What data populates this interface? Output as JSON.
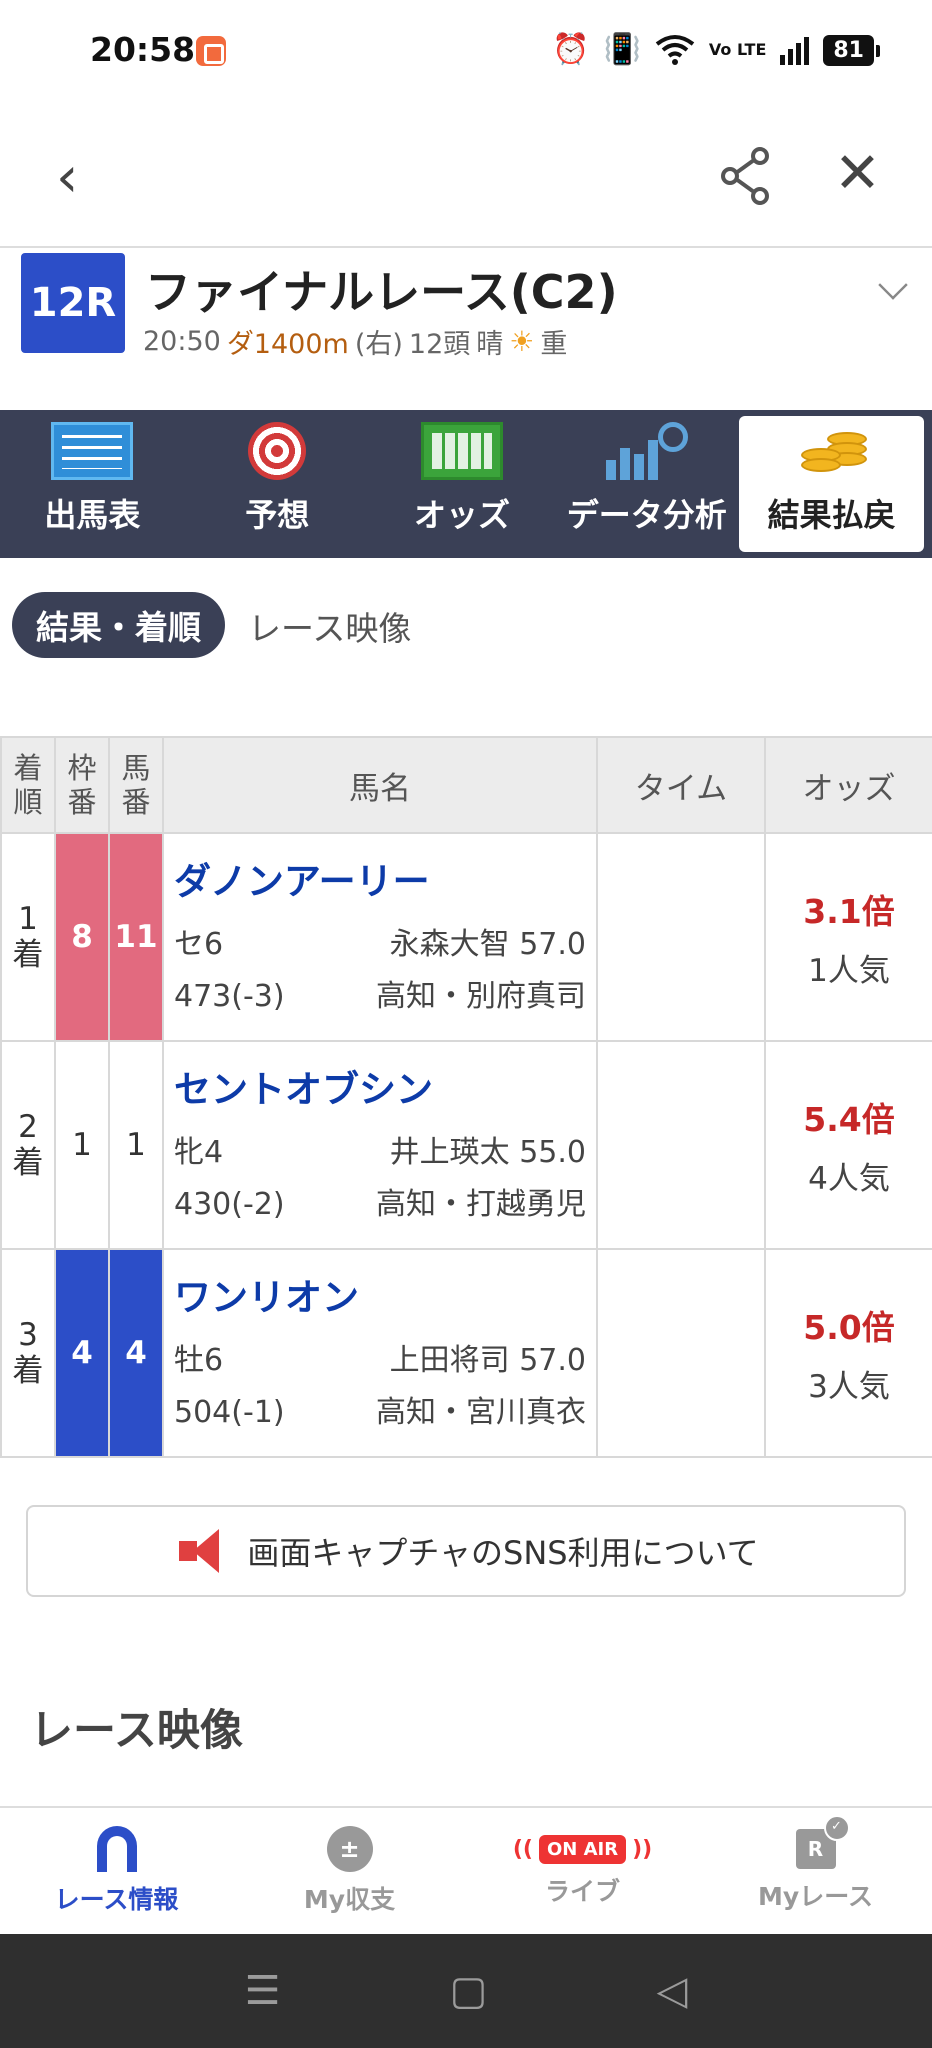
{
  "status_bar": {
    "time": "20:58",
    "battery": "81",
    "volte": "Vo LTE",
    "icons": [
      "alarm-icon",
      "vibrate-icon",
      "wifi-icon",
      "volte-icon",
      "signal-icon",
      "battery-icon"
    ]
  },
  "top_nav": {
    "back_icon": "‹",
    "close_icon": "✕"
  },
  "race": {
    "number": "12R",
    "name": "ファイナルレース(C2)",
    "start_time": "20:50",
    "distance": "ダ1400m",
    "direction": "(右)",
    "field_size": "12頭",
    "weather": "晴",
    "weather_icon": "☀",
    "track_condition": "重"
  },
  "main_tabs": [
    {
      "label": "出馬表",
      "icon": "entry-list-icon"
    },
    {
      "label": "予想",
      "icon": "target-icon"
    },
    {
      "label": "オッズ",
      "icon": "odds-board-icon"
    },
    {
      "label": "データ分析",
      "icon": "data-analysis-icon"
    },
    {
      "label": "結果払戻",
      "icon": "coins-icon",
      "active": true
    }
  ],
  "sub_tabs": {
    "active": "結果・着順",
    "other": "レース映像"
  },
  "table": {
    "headers": {
      "rank": "着順",
      "frame": "枠番",
      "horse_no": "馬番",
      "name": "馬名",
      "time": "タイム",
      "odds": "オッズ"
    },
    "rows": [
      {
        "rank_num": "1",
        "rank_suffix": "着",
        "frame": "8",
        "horse_no": "11",
        "name": "ダノンアーリー",
        "sex_age": "セ6",
        "jockey_weight": "永森大智 57.0",
        "body_weight": "473(-3)",
        "trainer": "高知・別府真司",
        "time": "",
        "odds": "3.1倍",
        "popularity": "1人気",
        "frame_color": "#e26a7f"
      },
      {
        "rank_num": "2",
        "rank_suffix": "着",
        "frame": "1",
        "horse_no": "1",
        "name": "セントオブシン",
        "sex_age": "牝4",
        "jockey_weight": "井上瑛太 55.0",
        "body_weight": "430(-2)",
        "trainer": "高知・打越勇児",
        "time": "",
        "odds": "5.4倍",
        "popularity": "4人気",
        "frame_color": "#ffffff"
      },
      {
        "rank_num": "3",
        "rank_suffix": "着",
        "frame": "4",
        "horse_no": "4",
        "name": "ワンリオン",
        "sex_age": "牡6",
        "jockey_weight": "上田将司 57.0",
        "body_weight": "504(-1)",
        "trainer": "高知・宮川真衣",
        "time": "",
        "odds": "5.0倍",
        "popularity": "3人気",
        "frame_color": "#2c4ec8"
      }
    ]
  },
  "sns_notice": {
    "text": "画面キャプチャのSNS利用について",
    "icon": "megaphone-icon"
  },
  "section_title": "レース映像",
  "bottom_nav": [
    {
      "label": "レース情報",
      "icon": "horseshoe-icon",
      "active": true
    },
    {
      "label": "My収支",
      "icon": "plus-minus-icon"
    },
    {
      "label": "ライブ",
      "icon": "on-air-icon",
      "badge": "ON AIR"
    },
    {
      "label": "Myレース",
      "icon": "my-race-icon",
      "glyph": "R"
    }
  ],
  "colors": {
    "accent": "#2c4ec8",
    "tabbar": "#3a4056",
    "odds_red": "#c62828",
    "horse_name_blue": "#0d3ba8"
  }
}
